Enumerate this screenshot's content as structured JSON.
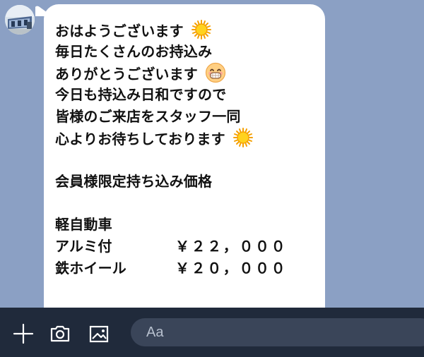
{
  "chat": {
    "message": {
      "lines": [
        "おはようございます",
        "毎日たくさんのお持込み",
        "ありがとうございます",
        "今日も持込み日和ですので",
        "皆様のご来店をスタッフ一同",
        "心よりお待ちしております",
        "",
        "会員様限定持ち込み価格",
        "",
        "軽自動車"
      ],
      "prices": [
        {
          "name": "アルミ付",
          "value": "￥２２，０００"
        },
        {
          "name": "鉄ホイール",
          "value": "￥２０，０００"
        }
      ],
      "emojis": {
        "line1": "sun-emoji",
        "line3": "grinning-face-emoji",
        "line6": "sun-emoji"
      }
    }
  },
  "composer": {
    "placeholder": "Aa",
    "buttons": [
      "plus-icon",
      "camera-icon",
      "image-icon"
    ]
  },
  "colors": {
    "background": "#8ba0c4",
    "bubble": "#ffffff",
    "composer": "#202a3b",
    "input": "#3a4559",
    "text": "#111111"
  }
}
